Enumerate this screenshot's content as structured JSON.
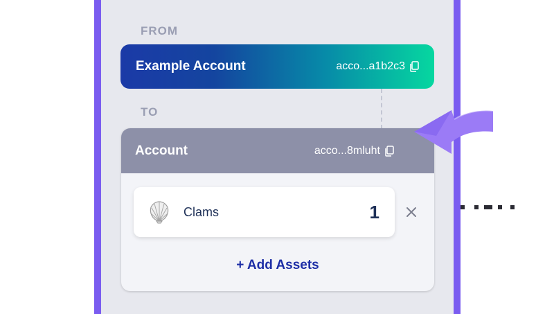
{
  "transfer": {
    "from_label": "FROM",
    "to_label": "TO",
    "from_account": {
      "name": "Example Account",
      "address": "acco...a1b2c3"
    },
    "to_account": {
      "name": "Account",
      "address": "acco...8mluht"
    },
    "assets": [
      {
        "name": "Clams",
        "quantity": "1",
        "icon": "shell-icon"
      }
    ],
    "add_assets_label": "+ Add Assets"
  },
  "colors": {
    "frame": "#7a5cf0",
    "from_gradient_start": "#1b3aa7",
    "from_gradient_end": "#06d7a0",
    "to_header": "#8d90a8",
    "link": "#1d2ea6",
    "arrow": "#9b7bf6"
  }
}
